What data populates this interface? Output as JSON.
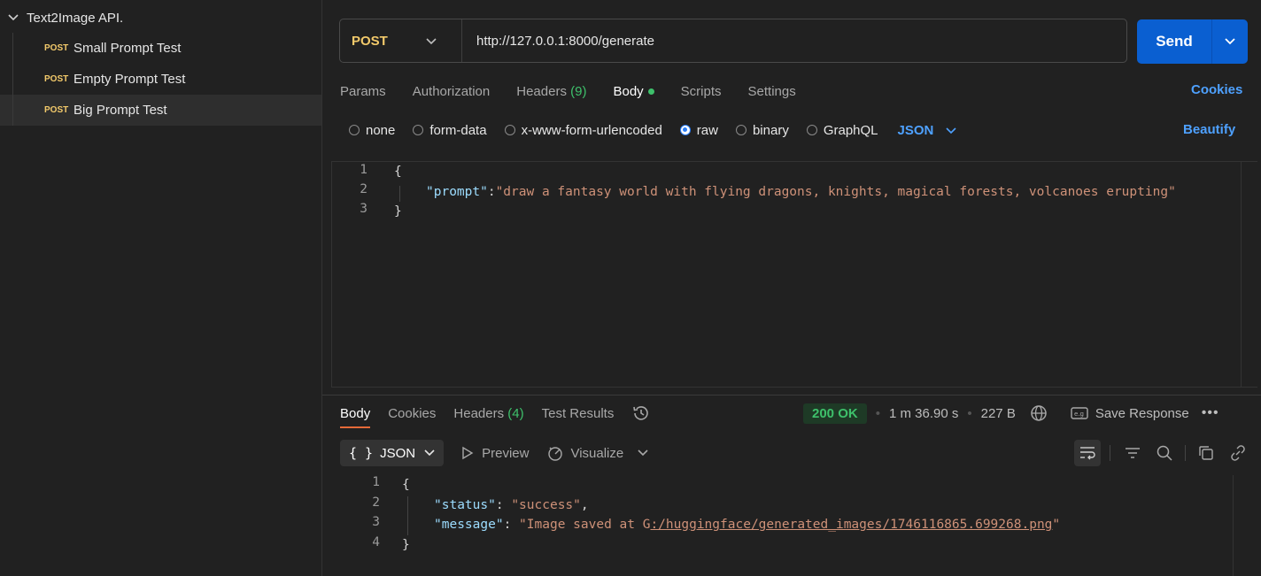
{
  "sidebar": {
    "collection_name": "Text2Image API.",
    "requests": [
      {
        "method": "POST",
        "label": "Small Prompt Test"
      },
      {
        "method": "POST",
        "label": "Empty Prompt Test"
      },
      {
        "method": "POST",
        "label": "Big Prompt Test"
      }
    ]
  },
  "request": {
    "method": "POST",
    "url": "http://127.0.0.1:8000/generate",
    "send_label": "Send",
    "tabs": {
      "params": "Params",
      "authorization": "Authorization",
      "headers": "Headers",
      "headers_count": "(9)",
      "body": "Body",
      "scripts": "Scripts",
      "settings": "Settings"
    },
    "cookies_link": "Cookies",
    "body_options": [
      "none",
      "form-data",
      "x-www-form-urlencoded",
      "raw",
      "binary",
      "GraphQL"
    ],
    "selected_body_option": "raw",
    "language": "JSON",
    "beautify_label": "Beautify",
    "editor": {
      "line_numbers": [
        "1",
        "2",
        "3"
      ],
      "open_brace": "{",
      "key": "\"prompt\"",
      "colon": ":",
      "value": "\"draw a fantasy world with flying dragons, knights, magical forests, volcanoes erupting\"",
      "close_brace": "}"
    }
  },
  "response": {
    "tabs": {
      "body": "Body",
      "cookies": "Cookies",
      "headers": "Headers",
      "headers_count": "(4)",
      "test_results": "Test Results"
    },
    "status": "200 OK",
    "time": "1 m 36.90 s",
    "size": "227 B",
    "save_label": "Save Response",
    "format": "JSON",
    "preview_label": "Preview",
    "visualize_label": "Visualize",
    "editor": {
      "line_numbers": [
        "1",
        "2",
        "3",
        "4"
      ],
      "open_brace": "{",
      "status_key": "\"status\"",
      "status_value": "\"success\"",
      "message_key": "\"message\"",
      "message_value_prefix": "\"Image saved at G",
      "message_value_link": ":/huggingface/generated_images/1746116865.699268.png",
      "message_value_suffix": "\"",
      "close_brace": "}"
    }
  },
  "colors": {
    "background": "#212121",
    "accent_blue": "#0a5fd1",
    "method_post": "#f3ca6b",
    "status_green": "#3ec06b",
    "tab_underline": "#e56a38"
  }
}
